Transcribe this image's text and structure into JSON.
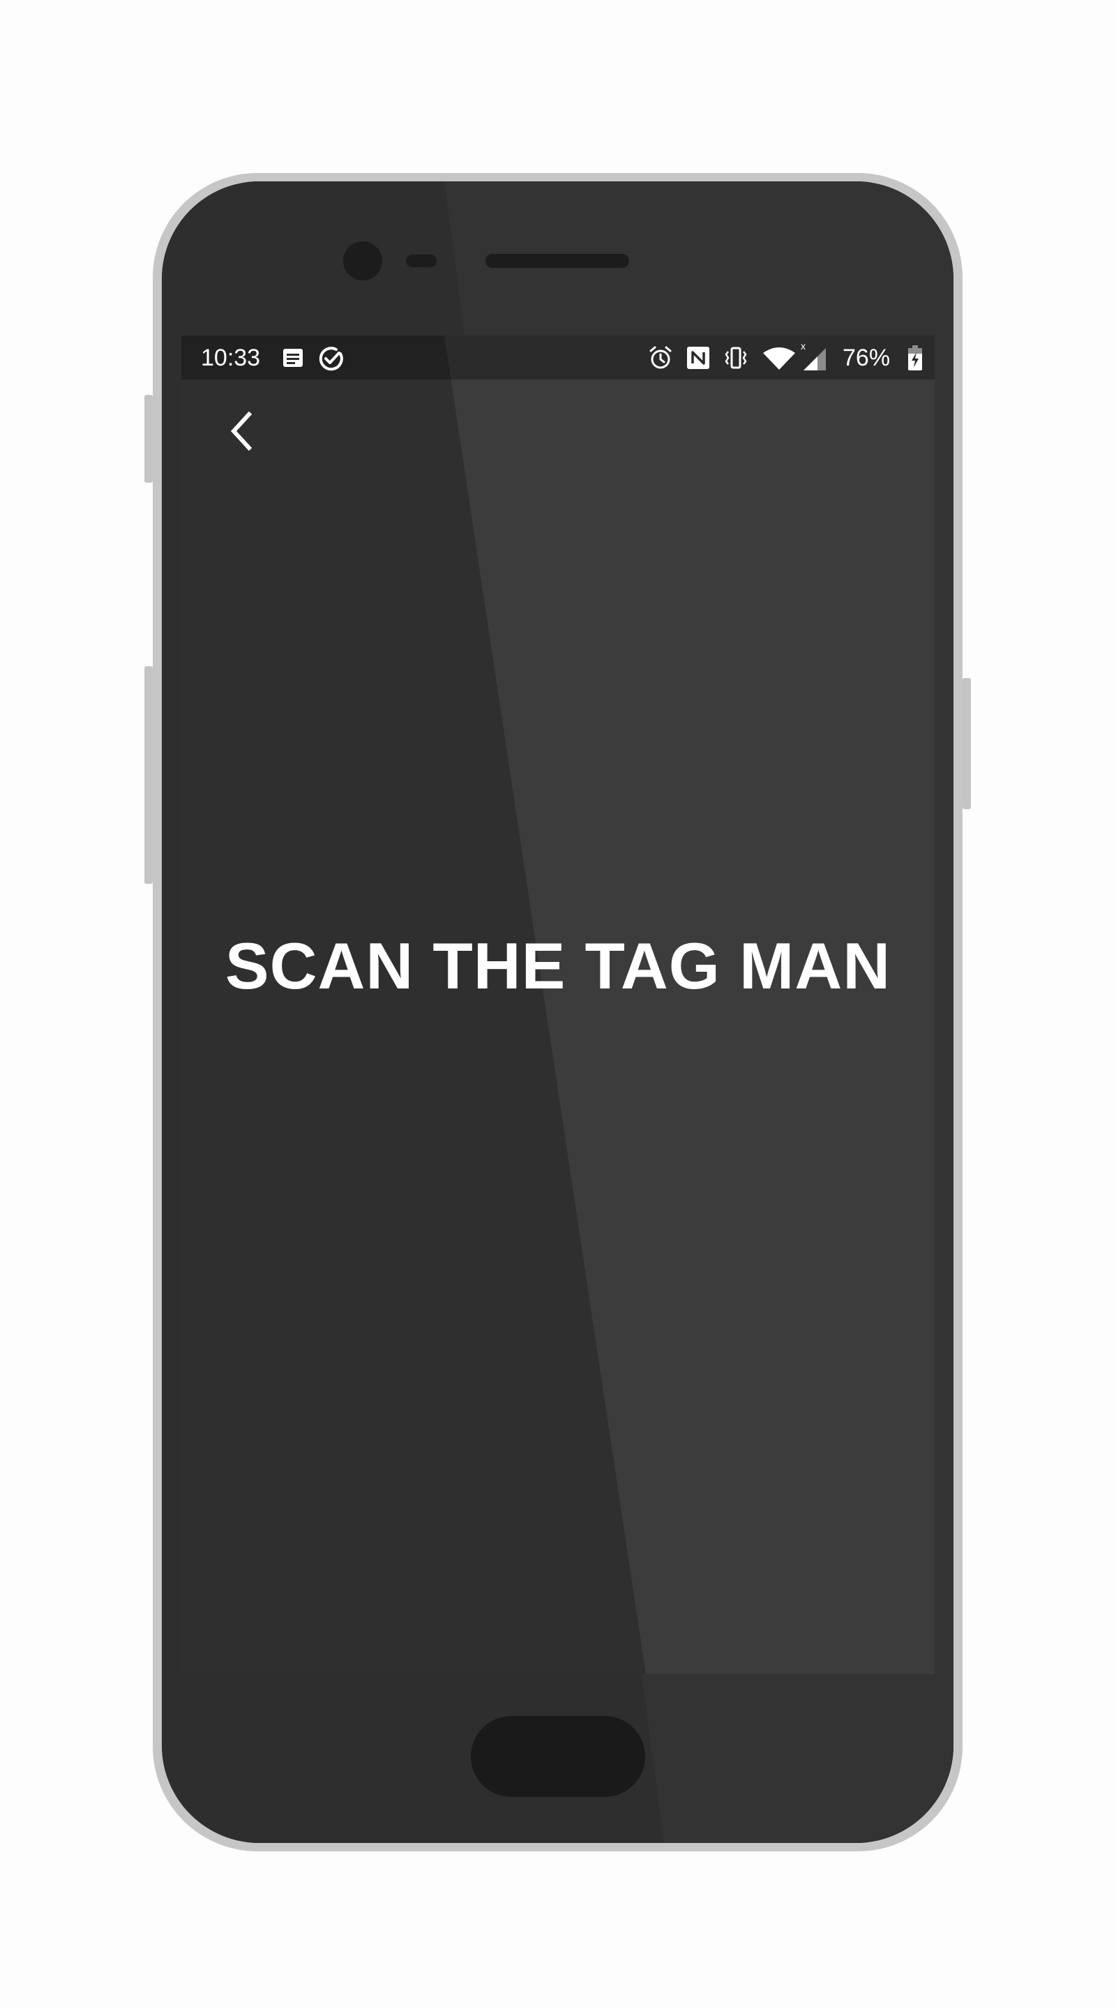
{
  "status_bar": {
    "time": "10:33",
    "battery_percent": "76%",
    "left_icons": [
      "notes-icon",
      "check-circle-icon"
    ],
    "right_icons": [
      "alarm-icon",
      "nfc-icon",
      "vibrate-icon",
      "wifi-icon",
      "signal-icon",
      "battery-charging-icon"
    ]
  },
  "toolbar": {
    "back_icon": "chevron-left-icon"
  },
  "main": {
    "headline": "SCAN THE TAG MAN"
  },
  "colors": {
    "screen_background": "#333333",
    "status_bar_background": "#242424",
    "text": "#ffffff",
    "phone_body": "#2e2e2e",
    "phone_frame": "#c6c6c6"
  }
}
